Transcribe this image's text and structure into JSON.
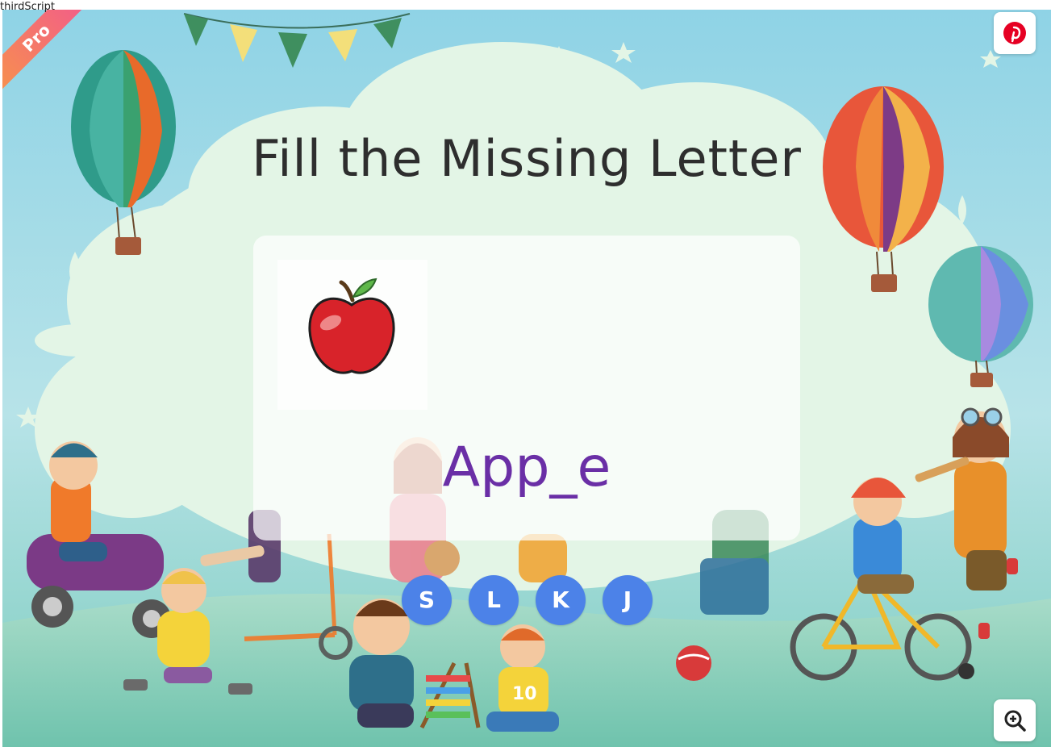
{
  "page": {
    "corner_text": "thirdScript",
    "badge_label": "Pro",
    "title": "Fill the Missing Letter"
  },
  "question": {
    "picture_icon": "apple-icon",
    "word": "App_e"
  },
  "options": [
    "S",
    "L",
    "K",
    "J"
  ],
  "icons": {
    "share": "pinterest-icon",
    "zoom": "zoom-in-icon"
  },
  "colors": {
    "option_bg": "#4c82e8",
    "word_color": "#6a2fa6",
    "pinterest_red": "#e60023",
    "ribbon_start": "#f7914d",
    "ribbon_end": "#f25a8c"
  }
}
